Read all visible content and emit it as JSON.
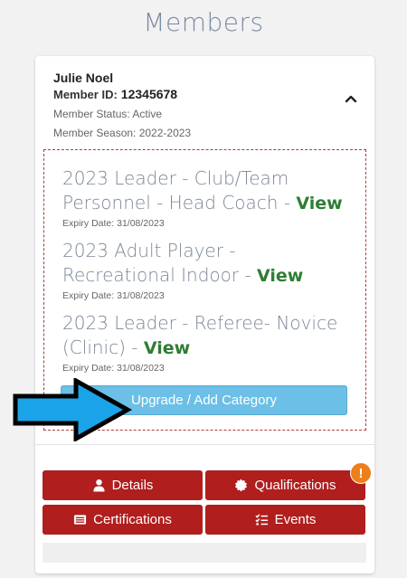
{
  "page": {
    "title": "Members"
  },
  "member": {
    "name": "Julie Noel",
    "id_label": "Member ID:",
    "id_value": "12345678",
    "status": "Member Status: Active",
    "season": "Member Season: 2022-2023"
  },
  "categories": [
    {
      "name": "2023 Leader - Club/Team Personnel - Head Coach",
      "separator": " - ",
      "view_label": "View",
      "expiry": "Expiry Date: 31/08/2023"
    },
    {
      "name": "2023 Adult Player - Recreational Indoor",
      "separator": " - ",
      "view_label": "View",
      "expiry": "Expiry Date: 31/08/2023"
    },
    {
      "name": "2023 Leader - Referee- Novice (Clinic)",
      "separator": " - ",
      "view_label": "View",
      "expiry": "Expiry Date: 31/08/2023"
    }
  ],
  "upgrade_button": {
    "label": "Upgrade / Add Category"
  },
  "actions": {
    "details": "Details",
    "qualifications": "Qualifications",
    "certifications": "Certifications",
    "events": "Events"
  },
  "alert_badge": {
    "text": "!"
  },
  "colors": {
    "title": "#7b8aa3",
    "view_link": "#2e7d32",
    "action_button": "#b01e1e",
    "upgrade_button": "#6cbfe6",
    "alert_badge": "#ef7f1a",
    "pointer_arrow": "#1aa3e8"
  },
  "icons": {
    "collapse": "chevron-up-icon",
    "details": "user-icon",
    "qualifications": "certificate-icon",
    "certifications": "id-card-icon",
    "events": "list-check-icon",
    "annotation": "arrow-right-icon"
  }
}
